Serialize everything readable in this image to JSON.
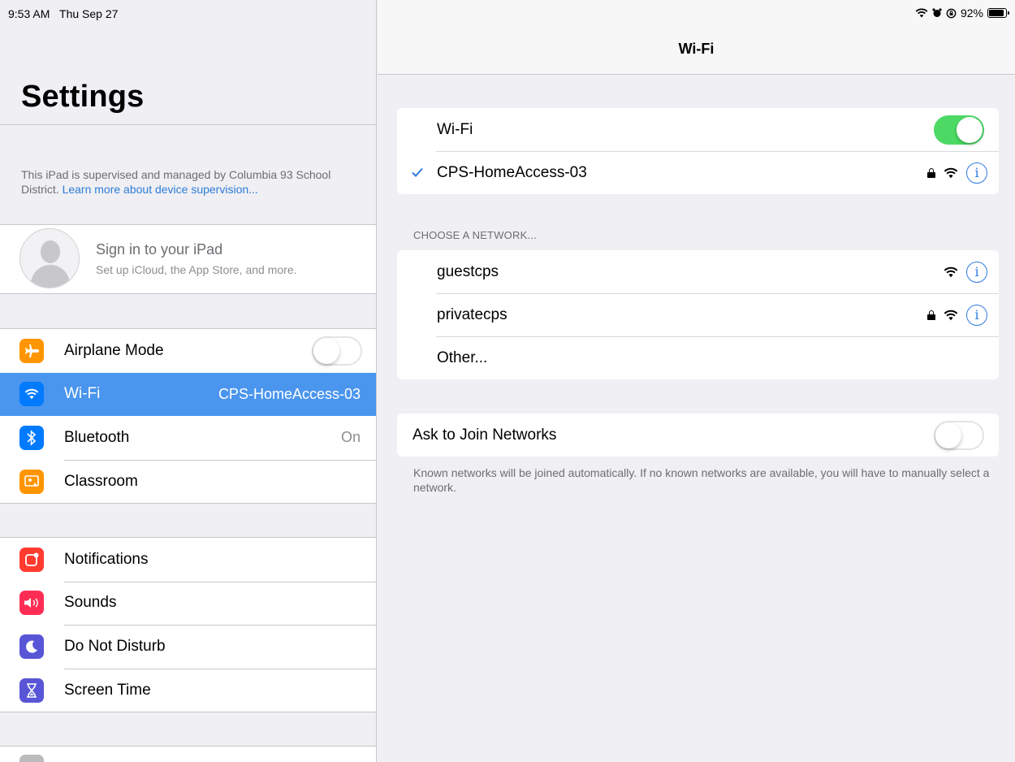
{
  "status_bar": {
    "time": "9:53 AM",
    "date": "Thu Sep 27",
    "battery": "92%",
    "battery_level": 0.92,
    "icons": [
      "wifi-icon",
      "alarm-icon",
      "orientation-lock-icon",
      "battery-icon"
    ]
  },
  "sidebar": {
    "title": "Settings",
    "supervision_text": "This iPad is supervised and managed by Columbia 93 School District.",
    "supervision_link": "Learn more about device supervision...",
    "signin": {
      "title": "Sign in to your iPad",
      "subtitle": "Set up iCloud, the App Store, and more."
    },
    "network_items": [
      {
        "label": "Airplane Mode",
        "icon": "airplane-icon",
        "color": "#ff9500",
        "toggle": false
      },
      {
        "label": "Wi-Fi",
        "icon": "wifi-icon",
        "color": "#007aff",
        "value": "CPS-HomeAccess-03",
        "selected": true
      },
      {
        "label": "Bluetooth",
        "icon": "bluetooth-icon",
        "color": "#007aff",
        "value": "On"
      },
      {
        "label": "Classroom",
        "icon": "classroom-icon",
        "color": "#ff9500"
      }
    ],
    "general_items": [
      {
        "label": "Notifications",
        "icon": "notifications-icon",
        "color": "#ff3b30"
      },
      {
        "label": "Sounds",
        "icon": "sounds-icon",
        "color": "#ff2d55"
      },
      {
        "label": "Do Not Disturb",
        "icon": "moon-icon",
        "color": "#5856d6"
      },
      {
        "label": "Screen Time",
        "icon": "hourglass-icon",
        "color": "#5856d6"
      }
    ]
  },
  "detail": {
    "title": "Wi-Fi",
    "wifi_label": "Wi-Fi",
    "wifi_on": true,
    "connected_network": "CPS-HomeAccess-03",
    "choose_header": "CHOOSE A NETWORK...",
    "networks": [
      {
        "name": "guestcps",
        "locked": false
      },
      {
        "name": "privatecps",
        "locked": true
      }
    ],
    "other_label": "Other...",
    "ask_to_join_label": "Ask to Join Networks",
    "ask_to_join_on": false,
    "footnote": "Known networks will be joined automatically. If no known networks are available, you will have to manually select a network.",
    "info_glyph": "i",
    "accent": "#2f7ce0",
    "toggle_on_color": "#4cd964"
  }
}
